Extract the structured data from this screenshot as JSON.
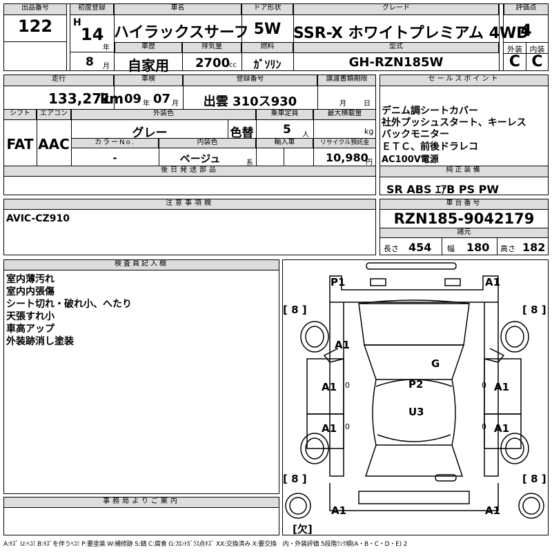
{
  "lot": {
    "label": "出品番号",
    "value": "122"
  },
  "first_reg": {
    "label": "初度登録",
    "era": "H",
    "year": "14",
    "year_unit": "年",
    "month": "8",
    "month_unit": "月"
  },
  "car_name": {
    "label": "車名",
    "value": "ハイラックスサーフ"
  },
  "doors": {
    "label": "ドア形状",
    "value": "5W"
  },
  "grade": {
    "label": "グレード",
    "value": "SSR-X ホワイトプレミアム 4WD"
  },
  "score": {
    "label": "評価点",
    "value": "4",
    "ext_label": "外装",
    "int_label": "内装",
    "ext": "C",
    "int": "C"
  },
  "history": {
    "label": "車歴",
    "value": "自家用"
  },
  "displacement": {
    "label": "排気量",
    "value": "2700",
    "unit": "cc"
  },
  "fuel": {
    "label": "燃料",
    "value": "ｶﾞｿﾘﾝ"
  },
  "model": {
    "label": "型式",
    "value": "GH-RZN185W"
  },
  "mileage": {
    "label": "走行",
    "value": "133,271",
    "unit": "km"
  },
  "inspection": {
    "label": "車検",
    "year": "09",
    "year_unit": "年",
    "month": "07",
    "month_unit": "月"
  },
  "plate": {
    "label": "登録番号",
    "value": "出雲 310ス930"
  },
  "transfer": {
    "label": "譲渡書類期限",
    "month_unit": "月",
    "day_unit": "日"
  },
  "sales_points": {
    "label": "セールスポイント",
    "lines": [
      "デニム調シートカバー",
      "社外プッシュスタート、キーレス",
      "バックモニター",
      "ＥＴＣ、前後ドラレコ",
      "AC100V電源"
    ]
  },
  "shift": {
    "label": "シフト",
    "value": "FAT"
  },
  "aircon": {
    "label": "エアコン",
    "value": "AAC"
  },
  "ext_color": {
    "label": "外装色",
    "value": "グレー",
    "note": "色替"
  },
  "capacity": {
    "label": "乗車定員",
    "value": "5",
    "unit": "人"
  },
  "max_load": {
    "label": "最大積載量",
    "unit": "kg"
  },
  "color_no": {
    "label": "カラーNo.",
    "value": "-"
  },
  "int_color": {
    "label": "内装色",
    "value": "ベージュ",
    "unit": "系"
  },
  "import": {
    "label": "輸入車"
  },
  "recycle": {
    "label": "リサイクル預託金",
    "value": "10,980",
    "unit": "円"
  },
  "later_parts": {
    "label": "後日発送部品"
  },
  "equipment": {
    "label": "純正装備",
    "value": "SR ABS ｴｱB PS PW"
  },
  "notes": {
    "label": "注意事項欄",
    "value": "AVIC-CZ910"
  },
  "chassis": {
    "label": "車台番号",
    "value": "RZN185-9042179"
  },
  "specs": {
    "label": "諸元",
    "length_label": "長さ",
    "length": "454",
    "width_label": "幅",
    "width": "180",
    "height_label": "高さ",
    "height": "182"
  },
  "inspector": {
    "label": "検査員記入欄",
    "lines": [
      "室内薄汚れ",
      "室内内張傷",
      "シート切れ・破れ小、へたり",
      "天張すれ小",
      "車高アップ",
      "外装跡消し塗装"
    ]
  },
  "office": {
    "label": "事務局よりご案内"
  },
  "damage_map": {
    "tire_fl": "[ 8 ]",
    "tire_fr": "[ 8 ]",
    "tire_rl": "[ 8 ]",
    "tire_rr": "[ 8 ]",
    "front_left": "P1",
    "front_right": "A1",
    "hood_left": "A1",
    "left_front_door": "A1",
    "left_front_door_mark": "0",
    "left_rear_door": "A1",
    "left_rear_door_mark": "0",
    "right_front_door": "A1",
    "right_front_door_mark": "0",
    "right_rear_door": "A1",
    "right_rear_door_mark": "0",
    "windshield": "G",
    "roof": "P2",
    "rear_roof": "U3",
    "rear_left": "A1",
    "rear_right": "A1",
    "spare": "[欠]"
  },
  "legend": "A:ｷｽﾞ U:ﾍｺﾐ B:ｷｽﾞを伴うﾍｺﾐ P:要塗装 W:補修跡 S:錆 C:腐食 G:ﾌﾛﾝﾄｶﾞﾗｽ点ｷｽﾞ XX:交換済み X:要交換　内・外装評価 5段階ﾗﾝｸ順(A・B・C・D・E) 2"
}
